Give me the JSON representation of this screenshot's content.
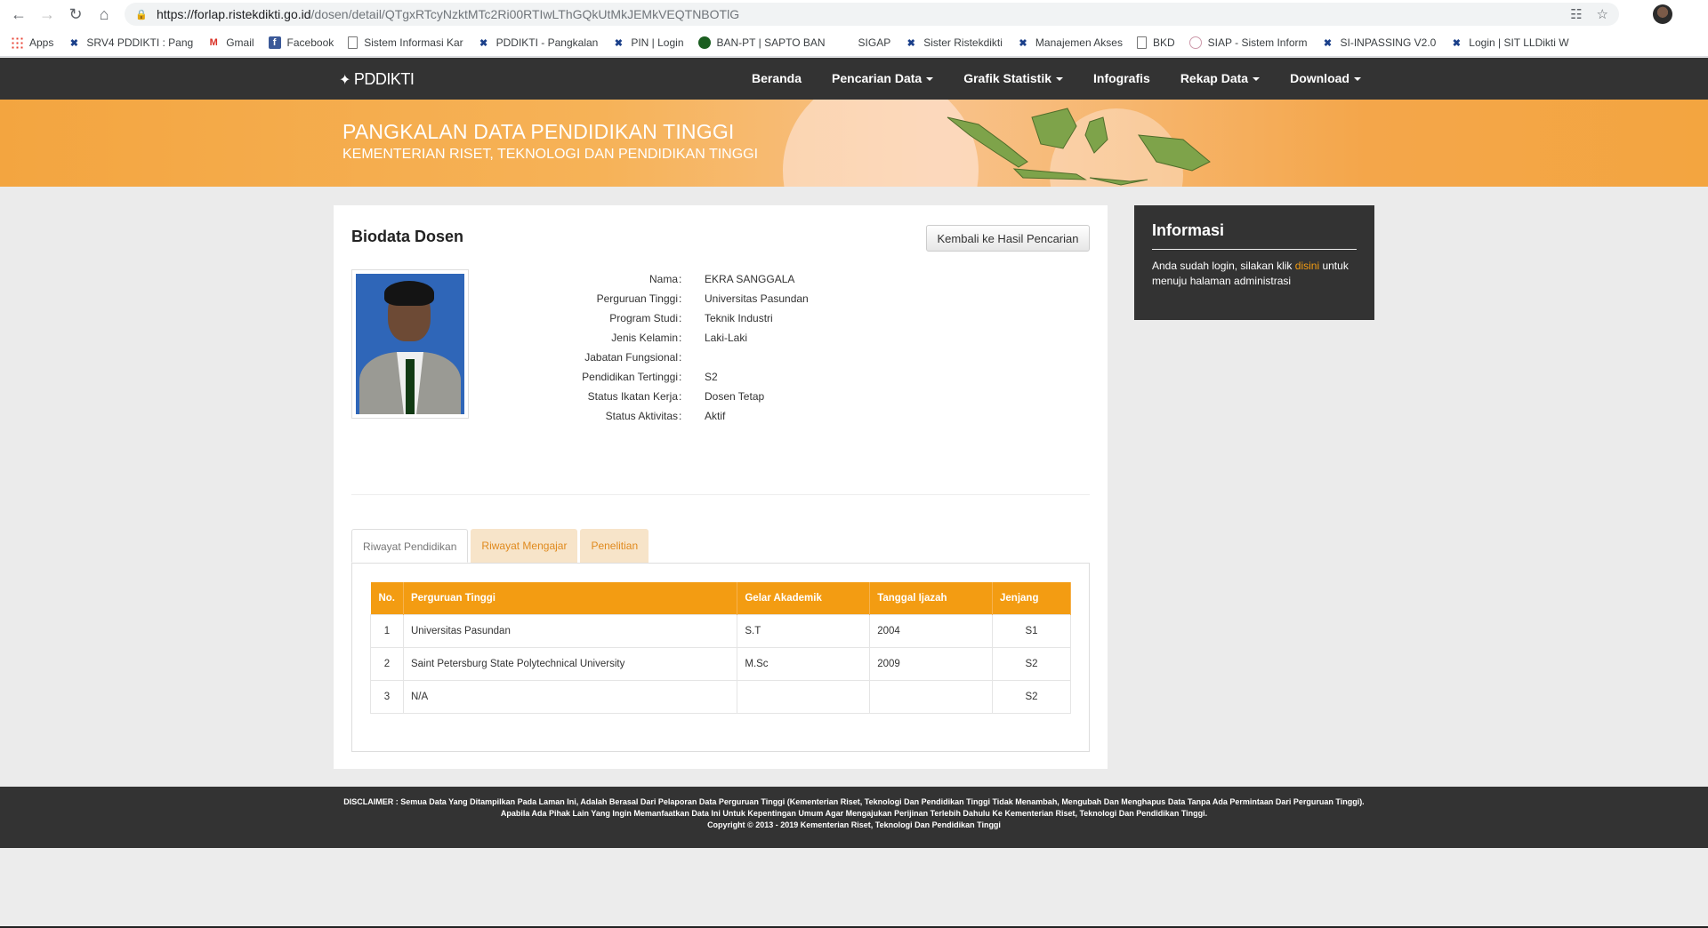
{
  "browser": {
    "url_host": "https://forlap.ristekdikti.go.id",
    "url_path": "/dosen/detail/QTgxRTcyNzktMTc2Ri00RTIwLThGQkUtMkJEMkVEQTNBOTlG",
    "bookmarks": [
      {
        "label": "Apps",
        "icon": "apps-grid-icon"
      },
      {
        "label": "SRV4 PDDIKTI : Pang",
        "icon": "kemenristek-icon"
      },
      {
        "label": "Gmail",
        "icon": "gmail-icon"
      },
      {
        "label": "Facebook",
        "icon": "facebook-icon"
      },
      {
        "label": "Sistem Informasi Kar",
        "icon": "page-icon"
      },
      {
        "label": "PDDIKTI - Pangkalan",
        "icon": "kemenristek-icon"
      },
      {
        "label": "PIN | Login",
        "icon": "kemenristek-icon"
      },
      {
        "label": "BAN-PT | SAPTO BAN",
        "icon": "banpt-icon"
      },
      {
        "label": "SIGAP",
        "icon": "blank-icon"
      },
      {
        "label": "Sister Ristekdikti",
        "icon": "kemenristek-icon"
      },
      {
        "label": "Manajemen Akses",
        "icon": "kemenristek-icon"
      },
      {
        "label": "BKD",
        "icon": "page-icon"
      },
      {
        "label": "SIAP - Sistem Inform",
        "icon": "siap-icon"
      },
      {
        "label": "SI-INPASSING V2.0",
        "icon": "kemenristek-icon"
      },
      {
        "label": "Login | SIT LLDikti W",
        "icon": "kemenristek-icon"
      }
    ]
  },
  "site": {
    "logo": "PDDIKTI",
    "menu": [
      {
        "label": "Beranda",
        "dropdown": false
      },
      {
        "label": "Pencarian Data",
        "dropdown": true
      },
      {
        "label": "Grafik Statistik",
        "dropdown": true
      },
      {
        "label": "Infografis",
        "dropdown": false
      },
      {
        "label": "Rekap Data",
        "dropdown": true
      },
      {
        "label": "Download",
        "dropdown": true
      }
    ],
    "banner_title": "PANGKALAN DATA PENDIDIKAN TINGGI",
    "banner_subtitle": "KEMENTERIAN RISET, TEKNOLOGI DAN PENDIDIKAN TINGGI"
  },
  "biodata": {
    "title": "Biodata Dosen",
    "back_button": "Kembali ke Hasil Pencarian",
    "fields": [
      {
        "label": "Nama",
        "value": "EKRA SANGGALA"
      },
      {
        "label": "Perguruan Tinggi",
        "value": "Universitas Pasundan"
      },
      {
        "label": "Program Studi",
        "value": "Teknik Industri"
      },
      {
        "label": "Jenis Kelamin",
        "value": "Laki-Laki"
      },
      {
        "label": "Jabatan Fungsional",
        "value": ""
      },
      {
        "label": "Pendidikan Tertinggi",
        "value": "S2"
      },
      {
        "label": "Status Ikatan Kerja",
        "value": "Dosen Tetap"
      },
      {
        "label": "Status Aktivitas",
        "value": "Aktif"
      }
    ],
    "colon": ":"
  },
  "tabs": [
    "Riwayat Pendidikan",
    "Riwayat Mengajar",
    "Penelitian"
  ],
  "education_table": {
    "headers": [
      "No.",
      "Perguruan Tinggi",
      "Gelar Akademik",
      "Tanggal Ijazah",
      "Jenjang"
    ],
    "rows": [
      [
        "1",
        "Universitas Pasundan",
        "S.T",
        "2004",
        "S1"
      ],
      [
        "2",
        "Saint Petersburg State Polytechnical University",
        "M.Sc",
        "2009",
        "S2"
      ],
      [
        "3",
        "N/A",
        "",
        "",
        "S2"
      ]
    ]
  },
  "info": {
    "title": "Informasi",
    "text_before": "Anda sudah login, silakan klik ",
    "link": "disini",
    "text_after": " untuk menuju halaman administrasi"
  },
  "footer": {
    "line1": "DISCLAIMER : Semua Data Yang Ditampilkan Pada Laman Ini, Adalah Berasal Dari Pelaporan Data Perguruan Tinggi (Kementerian Riset, Teknologi Dan Pendidikan Tinggi Tidak Menambah, Mengubah Dan Menghapus Data Tanpa Ada Permintaan Dari Perguruan Tinggi).",
    "line2": "Apabila Ada Pihak Lain Yang Ingin Memanfaatkan Data Ini Untuk Kepentingan Umum Agar Mengajukan Perijinan Terlebih Dahulu Ke Kementerian Riset, Teknologi Dan Pendidikan Tinggi.",
    "line3": "Copyright © 2013 - 2019 Kementerian Riset, Teknologi Dan Pendidikan Tinggi"
  },
  "colors": {
    "accent": "#f39c12",
    "nav_bg": "#333333"
  }
}
